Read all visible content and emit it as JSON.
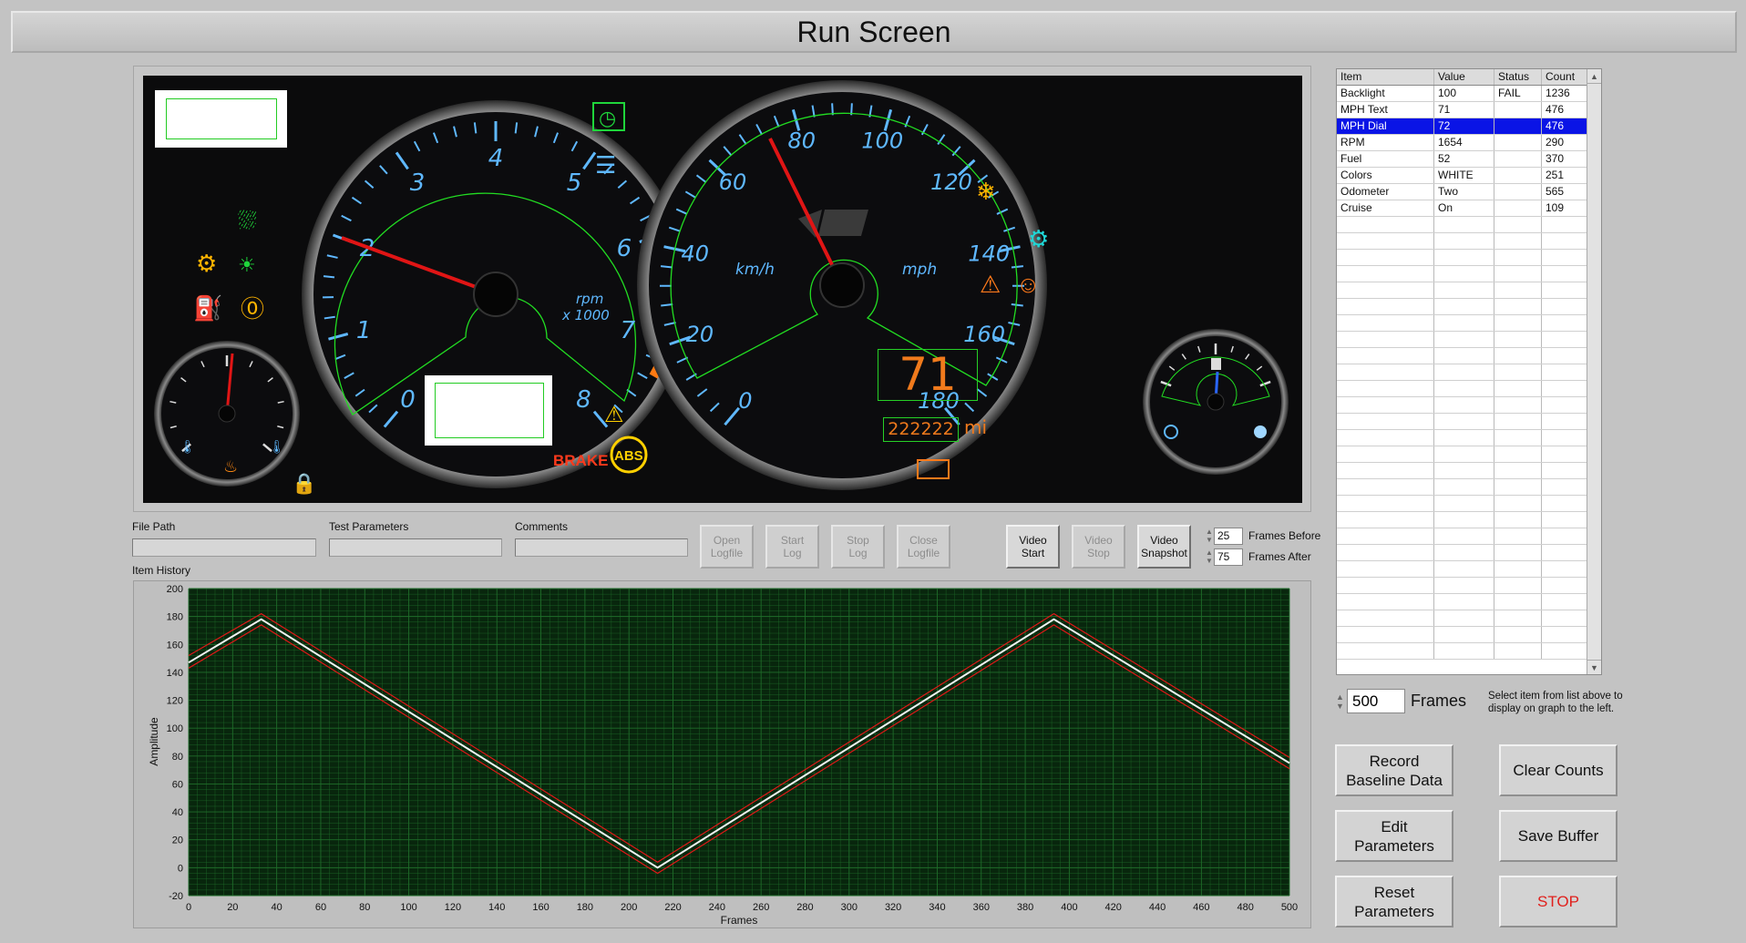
{
  "title": "Run Screen",
  "cluster": {
    "tach_labels": [
      "0",
      "1",
      "2",
      "3",
      "4",
      "5",
      "6",
      "7",
      "8"
    ],
    "tach_unit_line1": "rpm",
    "tach_unit_line2": "x 1000",
    "speedo_labels": [
      "0",
      "20",
      "40",
      "60",
      "80",
      "100",
      "120",
      "140",
      "160",
      "180"
    ],
    "speedo_unit_left": "km/h",
    "speedo_unit_right": "mph",
    "digital_speed": "71",
    "odometer": "222222",
    "odometer_unit": "mi",
    "brake_text": "BRAKE",
    "abs_text": "ABS",
    "colors": {
      "blue": "#5fb8ff",
      "green": "#1fd63b",
      "amber": "#ffb400",
      "red": "#ff3a1c",
      "orange": "#ff7a1a"
    }
  },
  "controls": {
    "file_path_label": "File Path",
    "file_path_value": "",
    "test_params_label": "Test Parameters",
    "test_params_value": "",
    "comments_label": "Comments",
    "comments_value": "",
    "buttons": {
      "open_log": "Open\nLogfile",
      "start_log": "Start\nLog",
      "stop_log": "Stop\nLog",
      "close_log": "Close\nLogfile",
      "video_start": "Video\nStart",
      "video_stop": "Video\nStop",
      "video_snapshot": "Video\nSnapshot"
    },
    "frames_before_value": "25",
    "frames_before_label": "Frames Before",
    "frames_after_value": "75",
    "frames_after_label": "Frames After"
  },
  "graph": {
    "label": "Item History"
  },
  "chart_data": {
    "type": "line",
    "title": "",
    "xlabel": "Frames",
    "ylabel": "Amplitude",
    "xlim": [
      0,
      500
    ],
    "ylim": [
      -20,
      200
    ],
    "xticks": [
      0,
      20,
      40,
      60,
      80,
      100,
      120,
      140,
      160,
      180,
      200,
      220,
      240,
      260,
      280,
      300,
      320,
      340,
      360,
      380,
      400,
      420,
      440,
      460,
      480,
      500
    ],
    "yticks": [
      -20,
      0,
      20,
      40,
      60,
      80,
      100,
      120,
      140,
      160,
      180,
      200
    ],
    "grid": true,
    "colors": {
      "plot_bg": "#08260d",
      "grid": "#1f6d2a",
      "signal": "#f2f2f2",
      "limits": "#e01818"
    },
    "series": [
      {
        "x": [
          0,
          33,
          213,
          393,
          500
        ],
        "y": [
          147,
          178,
          0,
          178,
          75
        ]
      },
      {
        "x": [
          0,
          33,
          213,
          393,
          500
        ],
        "y": [
          152,
          182,
          4,
          182,
          79
        ]
      },
      {
        "x": [
          0,
          33,
          213,
          393,
          500
        ],
        "y": [
          143,
          174,
          -4,
          174,
          71
        ]
      }
    ]
  },
  "table": {
    "headers": [
      "Item",
      "Value",
      "Status",
      "Count"
    ],
    "rows": [
      {
        "item": "Backlight",
        "value": "100",
        "status": "FAIL",
        "count": "1236"
      },
      {
        "item": "MPH Text",
        "value": "71",
        "status": "",
        "count": "476"
      },
      {
        "item": "MPH Dial",
        "value": "72",
        "status": "",
        "count": "476",
        "selected": true
      },
      {
        "item": "RPM",
        "value": "1654",
        "status": "",
        "count": "290"
      },
      {
        "item": "Fuel",
        "value": "52",
        "status": "",
        "count": "370"
      },
      {
        "item": "Colors",
        "value": "WHITE",
        "status": "",
        "count": "251"
      },
      {
        "item": "Odometer",
        "value": "Two",
        "status": "",
        "count": "565"
      },
      {
        "item": "Cruise",
        "value": "On",
        "status": "",
        "count": "109"
      }
    ]
  },
  "frames_ctl": {
    "value": "500",
    "label": "Frames"
  },
  "hint": "Select item from list above to display on graph to the left.",
  "buttons": {
    "record_baseline": "Record\nBaseline Data",
    "clear_counts": "Clear Counts",
    "edit_params": "Edit\nParameters",
    "save_buffer": "Save Buffer",
    "reset_params": "Reset\nParameters",
    "stop": "STOP"
  }
}
